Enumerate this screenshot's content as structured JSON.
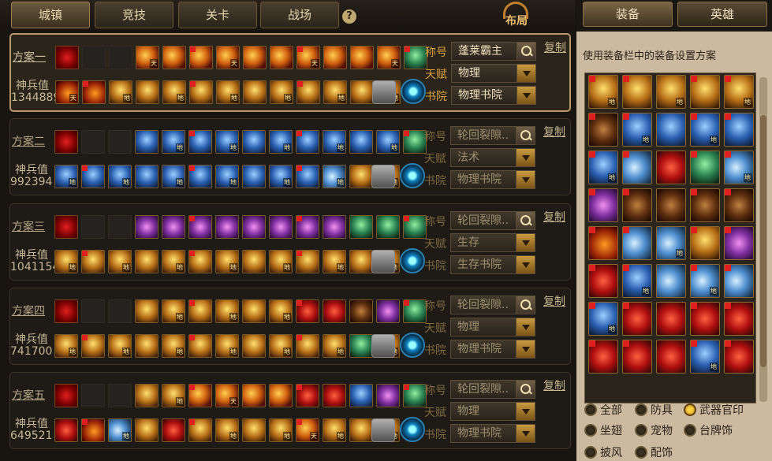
{
  "top_tabs": [
    {
      "label": "城镇",
      "active": true
    },
    {
      "label": "竞技",
      "active": false
    },
    {
      "label": "关卡",
      "active": false
    },
    {
      "label": "战场",
      "active": false
    }
  ],
  "help_label": "?",
  "layout_label": "布局",
  "right_tabs": [
    {
      "label": "装备",
      "active": true
    },
    {
      "label": "英雄",
      "active": false
    }
  ],
  "labels": {
    "power": "神兵值",
    "title": "称号",
    "talent": "天赋",
    "academy": "书院",
    "copy": "复制"
  },
  "plans": [
    {
      "name": "方案一",
      "power": "1344889",
      "title": "蓬莱霸主",
      "talent": "物理",
      "academy": "物理书院",
      "active": true,
      "top": [
        "seal",
        "empty",
        "empty",
        "fire",
        "fire",
        "fire",
        "fire",
        "fire",
        "fire",
        "fire",
        "fire",
        "fire",
        "fire",
        "green"
      ],
      "bottom": [
        "flame",
        "flame",
        "gold",
        "gold",
        "gold",
        "gold",
        "gold",
        "gold",
        "gold",
        "gold",
        "gold",
        "gold",
        "gold"
      ]
    },
    {
      "name": "方案二",
      "power": "992394",
      "title": "轮回裂隙..",
      "talent": "法术",
      "academy": "物理书院",
      "active": false,
      "top": [
        "seal",
        "empty",
        "empty",
        "blue",
        "blue",
        "blue",
        "blue",
        "blue",
        "blue",
        "blue",
        "blue",
        "blue",
        "blue",
        "green"
      ],
      "bottom": [
        "blue",
        "blue",
        "blue",
        "blue",
        "blue",
        "blue",
        "blue",
        "blue",
        "blue",
        "blue",
        "ice",
        "gold",
        "gold"
      ]
    },
    {
      "name": "方案三",
      "power": "1041154",
      "title": "轮回裂隙..",
      "talent": "生存",
      "academy": "生存书院",
      "active": false,
      "top": [
        "seal",
        "empty",
        "empty",
        "purple",
        "purple",
        "purple",
        "purple",
        "purple",
        "purple",
        "purple",
        "purple",
        "green",
        "green",
        "green"
      ],
      "bottom": [
        "gold",
        "gold",
        "gold",
        "gold",
        "gold",
        "gold",
        "gold",
        "gold",
        "gold",
        "gold",
        "gold",
        "gold",
        "gold"
      ]
    },
    {
      "name": "方案四",
      "power": "741700",
      "title": "轮回裂隙..",
      "talent": "物理",
      "academy": "物理书院",
      "active": false,
      "top": [
        "seal",
        "empty",
        "empty",
        "gold",
        "gold",
        "gold",
        "gold",
        "gold",
        "gold",
        "red",
        "red",
        "dark",
        "purple",
        "green"
      ],
      "bottom": [
        "gold",
        "gold",
        "gold",
        "gold",
        "gold",
        "gold",
        "gold",
        "gold",
        "gold",
        "gold",
        "gold",
        "green",
        "gold"
      ]
    },
    {
      "name": "方案五",
      "power": "649521",
      "title": "轮回裂隙..",
      "talent": "物理",
      "academy": "物理书院",
      "active": false,
      "top": [
        "seal",
        "empty",
        "empty",
        "gold",
        "gold",
        "fire",
        "fire",
        "fire",
        "fire",
        "red",
        "red",
        "blue",
        "purple",
        "green"
      ],
      "bottom": [
        "red",
        "flame",
        "ice",
        "gold",
        "red",
        "gold",
        "gold",
        "gold",
        "gold",
        "fire",
        "gold",
        "gold",
        "gold"
      ]
    }
  ],
  "right_panel": {
    "hint": "使用装备栏中的装备设置方案",
    "items": [
      "gold",
      "gold",
      "gold",
      "gold",
      "gold",
      "dark",
      "blue",
      "blue",
      "blue",
      "blue",
      "blue",
      "ice",
      "red",
      "green",
      "ice",
      "purple",
      "dark",
      "dark",
      "dark",
      "dark",
      "flame",
      "ice",
      "ice",
      "gold",
      "purple",
      "red",
      "blue",
      "ice",
      "ice",
      "ice",
      "blue",
      "red",
      "red",
      "red",
      "red",
      "red",
      "red",
      "red",
      "blue",
      "red"
    ],
    "filters": [
      {
        "label": "全部",
        "on": false
      },
      {
        "label": "防具",
        "on": false
      },
      {
        "label": "武器官印",
        "on": true
      },
      {
        "label": "坐翅",
        "on": false
      },
      {
        "label": "宠物",
        "on": false
      },
      {
        "label": "台牌饰",
        "on": false
      },
      {
        "label": "披风",
        "on": false
      },
      {
        "label": "配饰",
        "on": false
      }
    ]
  },
  "tags": {
    "heaven": "天",
    "earth": "地"
  }
}
